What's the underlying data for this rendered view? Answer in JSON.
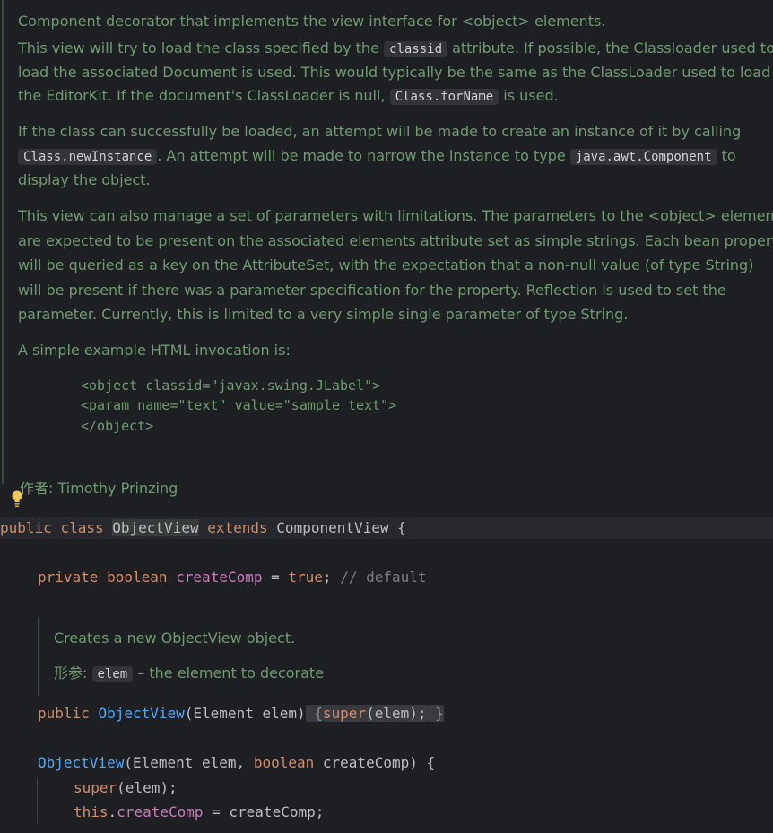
{
  "class_doc": {
    "line1": "Component decorator that implements the view interface for <object> elements.",
    "p1": {
      "l1_a": "This view will try to load the class specified by the ",
      "l1_code": "classid",
      "l1_b": " attribute. If possible, the Classloader used to",
      "l2": "load the associated Document is used. This would typically be the same as the ClassLoader used to load",
      "l3_a": "the EditorKit. If the document's ClassLoader is null, ",
      "l3_code": "Class.forName",
      "l3_b": " is used."
    },
    "p2": {
      "l1": "If the class can successfully be loaded, an attempt will be made to create an instance of it by calling",
      "l2_code1": "Class.newInstance",
      "l2_a": ". An attempt will be made to narrow the instance to type ",
      "l2_code2": "java.awt.Component",
      "l2_b": " to",
      "l3": "display the object."
    },
    "p3": {
      "l1": "This view can also manage a set of parameters with limitations. The parameters to the <object> element",
      "l2": "are expected to be present on the associated elements attribute set as simple strings. Each bean property",
      "l3": "will be queried as a key on the AttributeSet, with the expectation that a non-null value (of type String)",
      "l4": "will be present if there was a parameter specification for the property. Reflection is used to set the",
      "l5": "parameter. Currently, this is limited to a very simple single parameter of type String."
    },
    "example_intro": "A simple example HTML invocation is:",
    "example_code": [
      "<object classid=\"javax.swing.JLabel\">",
      "<param name=\"text\" value=\"sample text\">",
      "</object>"
    ],
    "author_label": "作者:",
    "author_name": "Timothy Prinzing"
  },
  "code": {
    "class_decl": {
      "kw1": "public",
      "kw2": "class",
      "name": "ObjectView",
      "kw3": "extends",
      "super": "ComponentView",
      "brace": "{"
    },
    "field": {
      "kw1": "private",
      "kw2": "boolean",
      "name": "createComp",
      "eq": " = ",
      "value": "true",
      "semi": ";",
      "comment": "// default"
    },
    "ctor_doc": {
      "desc": "Creates a new ObjectView object.",
      "param_label": "形参:",
      "param_code": "elem",
      "param_desc": " – the element to decorate"
    },
    "ctor1": {
      "kw": "public",
      "name": "ObjectView",
      "params": "(Element elem)",
      "open": " {",
      "super_kw": "super",
      "args": "(elem);",
      "close": " }"
    },
    "ctor2": {
      "name": "ObjectView",
      "params_a": "(Element elem, ",
      "kw": "boolean",
      "params_b": " createComp) {",
      "line1_kw": "super",
      "line1_rest": "(elem);",
      "line2_kw": "this",
      "line2_dot": ".",
      "line2_field": "createComp",
      "line2_rest": " = createComp;"
    }
  },
  "icons": {
    "bulb": "lightbulb-icon"
  },
  "colors": {
    "background": "#1e1f22",
    "doc_text": "#6f9b72",
    "keyword": "#cf8e6d",
    "field": "#c77dbb",
    "method": "#56a8f5",
    "bulb": "#f2c55c"
  }
}
